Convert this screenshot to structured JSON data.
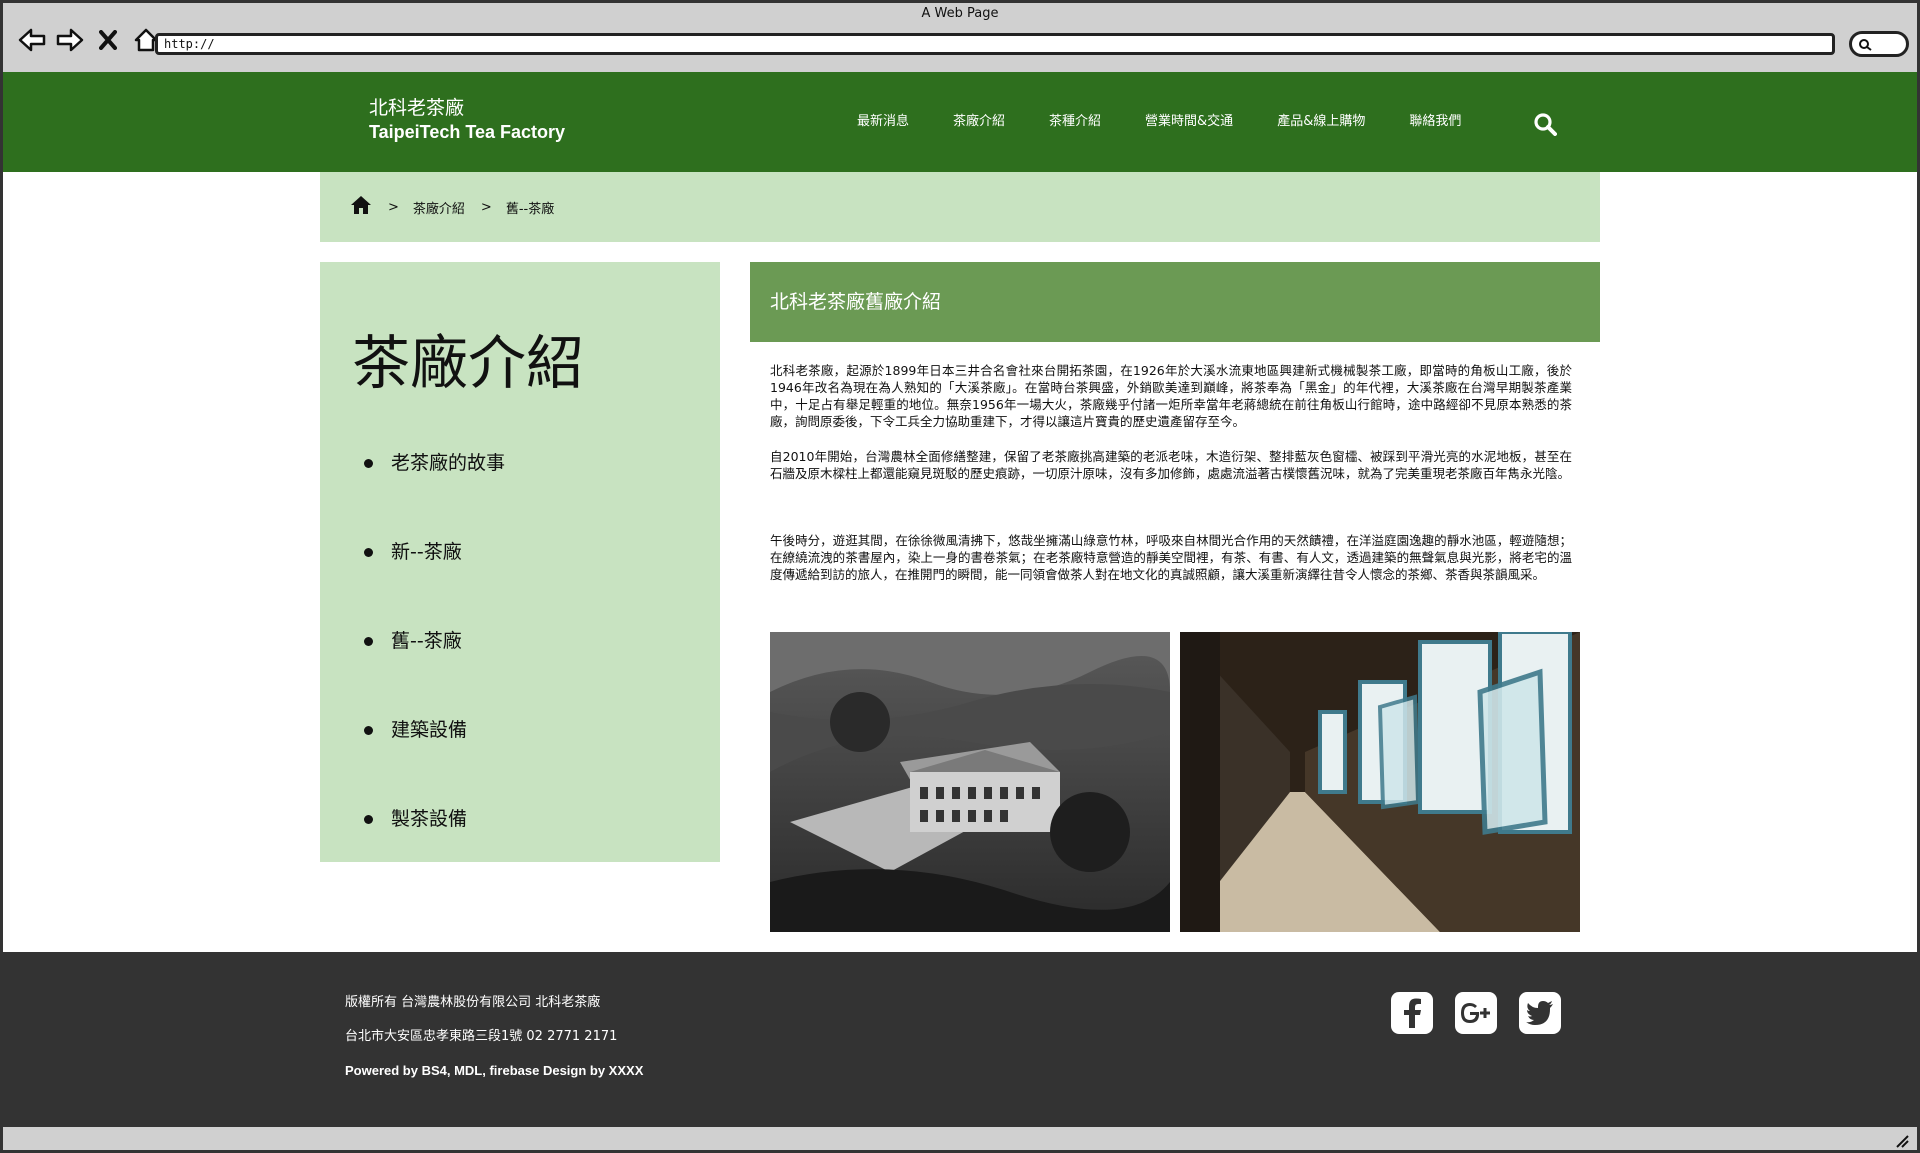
{
  "browser": {
    "title": "A Web Page",
    "url": "http://"
  },
  "header": {
    "brand_cn": "北科老茶廠",
    "brand_en": "TaipeiTech Tea Factory",
    "nav": [
      "最新消息",
      "茶廠介紹",
      "茶種介紹",
      "營業時間&交通",
      "產品&線上購物",
      "聯絡我們"
    ]
  },
  "breadcrumb": {
    "sep1": ">",
    "item1": "茶廠介紹",
    "sep2": ">",
    "item2": "舊--茶廠"
  },
  "sidebar": {
    "title": "茶廠介紹",
    "items": [
      "老茶廠的故事",
      "新--茶廠",
      "舊--茶廠",
      "建築設備",
      "製茶設備"
    ]
  },
  "main": {
    "heading": "北科老茶廠舊廠介紹",
    "p1": "北科老茶廠，起源於1899年日本三井合名會社來台開拓茶園，在1926年於大溪水流東地區興建新式機械製茶工廠，即當時的角板山工廠，後於1946年改名為現在為人熟知的「大溪茶廠」。在當時台茶興盛，外銷歐美達到巔峰，將茶奉為「黑金」的年代裡，大溪茶廠在台灣早期製茶產業中，十足占有舉足輕重的地位。無奈1956年一場大火，茶廠幾乎付諸一炬所幸當年老蔣總統在前往角板山行館時，途中路經卻不見原本熟悉的茶廠，詢問原委後，下令工兵全力協助重建下，才得以讓這片寶貴的歷史遺產留存至今。",
    "p2": "自2010年開始，台灣農林全面修繕整建，保留了老茶廠挑高建築的老派老味，木造衍架、整排藍灰色窗櫺、被踩到平滑光亮的水泥地板，甚至在石牆及原木樑柱上都還能窺見斑駁的歷史痕跡，一切原汁原味，沒有多加修飾，處處流溢著古樸懷舊況味，就為了完美重現老茶廠百年雋永光陰。",
    "p3": "午後時分，遊逛其間，在徐徐微風清拂下，悠哉坐擁滿山綠意竹林，呼吸來自林間光合作用的天然饋禮，在洋溢庭園逸趣的靜水池區，輕遊隨想；在繚繞流洩的茶書屋內，染上一身的書卷茶氣；在老茶廠特意營造的靜美空間裡，有茶、有書、有人文，透過建築的無聲氣息與光影，將老宅的溫度傳遞給到訪的旅人，在推開門的瞬間，能一同領會做茶人對在地文化的真誠照顧，讓大溪重新演繹往昔令人懷念的茶鄉、茶香與茶韻風采。"
  },
  "footer": {
    "line1": "版權所有 台灣農林股份有限公司 北科老茶廠",
    "line2": "台北市大安區忠孝東路三段1號 02 2771 2171",
    "line3": "Powered by BS4, MDL, firebase Design by XXXX"
  },
  "colors": {
    "header_green": "#2e6f1e",
    "light_green": "#c8e3c1",
    "mid_green": "#6b9a54",
    "footer_dark": "#333333"
  }
}
